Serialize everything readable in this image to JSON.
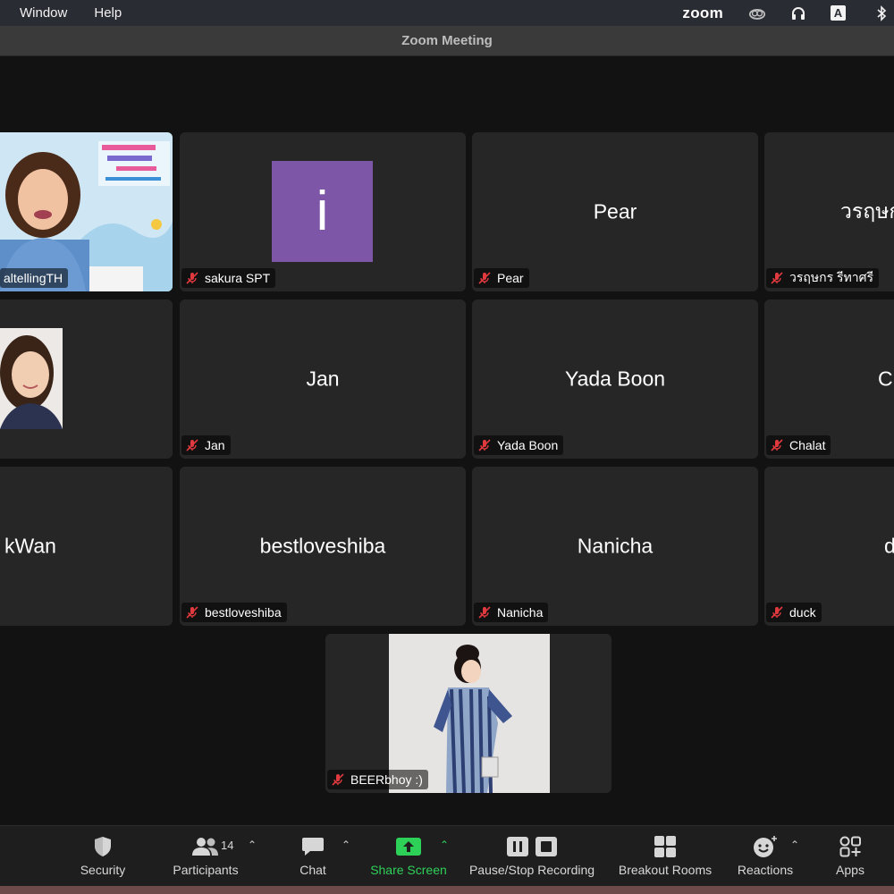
{
  "menubar": {
    "items": [
      "Window",
      "Help"
    ],
    "app_logo": "zoom"
  },
  "window": {
    "title": "Zoom Meeting"
  },
  "tiles": [
    {
      "name": "altellingTH",
      "kind": "video",
      "active": true
    },
    {
      "name": "sakura SPT",
      "kind": "avatar",
      "avatar_letter": "i",
      "avatar_color": "#7d56a8"
    },
    {
      "name": "Pear",
      "kind": "name",
      "display": "Pear"
    },
    {
      "name": "วรฤษกร รีทาศรี",
      "kind": "name",
      "display": "วรฤษก"
    },
    {
      "name": "",
      "kind": "video"
    },
    {
      "name": "Jan",
      "kind": "name",
      "display": "Jan"
    },
    {
      "name": "Yada Boon",
      "kind": "name",
      "display": "Yada Boon"
    },
    {
      "name": "Chalat",
      "kind": "name",
      "display": "Cl"
    },
    {
      "name": "",
      "kind": "name",
      "display": "kWan"
    },
    {
      "name": "bestloveshiba",
      "kind": "name",
      "display": "bestloveshiba"
    },
    {
      "name": "Nanicha",
      "kind": "name",
      "display": "Nanicha"
    },
    {
      "name": "duck",
      "kind": "name",
      "display": "d"
    },
    {
      "name": "BEERbhoy :)",
      "kind": "video"
    }
  ],
  "toolbar": {
    "security": "Security",
    "participants": "Participants",
    "participants_count": "14",
    "chat": "Chat",
    "share_screen": "Share Screen",
    "recording": "Pause/Stop Recording",
    "breakout": "Breakout Rooms",
    "reactions": "Reactions",
    "apps": "Apps"
  },
  "colors": {
    "active_speaker": "#44c767",
    "share_green": "#2ed158",
    "mute_red": "#e0393e"
  }
}
